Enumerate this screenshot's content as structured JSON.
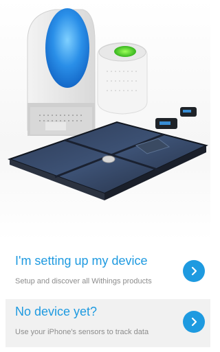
{
  "hero": {
    "scale_display_icon": "scale-display-icon",
    "aura_icon": "aura-lamp-icon",
    "pulse_icon": "activity-tracker-icon",
    "cuff_icon": "blood-pressure-cuff-icon",
    "scale_icon": "smart-scale-icon"
  },
  "options": [
    {
      "title": "I'm setting up my device",
      "subtitle": "Setup and discover all Withings products",
      "icon": "chevron-right-icon"
    },
    {
      "title": "No device yet?",
      "subtitle": "Use your iPhone's sensors to track data",
      "icon": "chevron-right-icon"
    }
  ],
  "colors": {
    "accent": "#1e9ae0",
    "subtitle": "#8c8c8c",
    "second_row_bg": "#f1f1f1"
  }
}
